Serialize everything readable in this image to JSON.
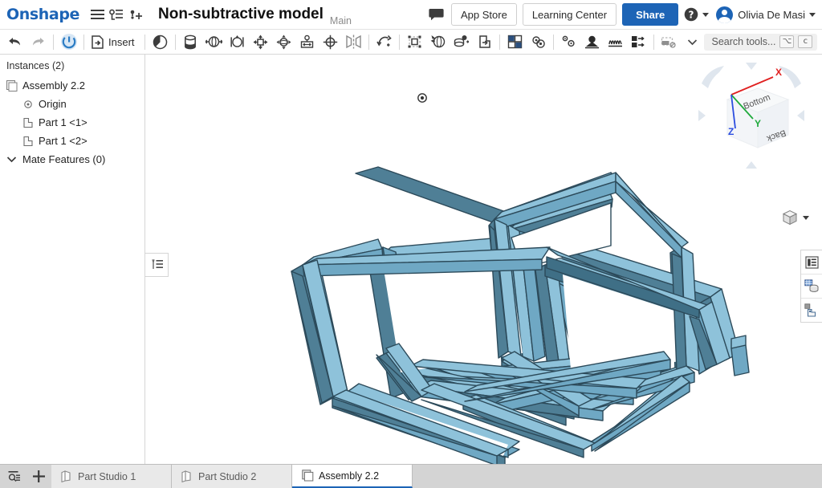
{
  "header": {
    "brand": "Onshape",
    "menu_icon": "hamburger-menu-icon",
    "versions_icon": "version-graph-icon",
    "branch_icon": "create-branch-icon",
    "document_title": "Non-subtractive model",
    "branch_label": "Main",
    "comment_icon": "comment-icon",
    "app_store_label": "App Store",
    "learning_center_label": "Learning Center",
    "share_label": "Share",
    "help_icon": "help-icon",
    "user_name": "Olivia De Masi",
    "avatar": "user-avatar"
  },
  "toolbar": {
    "undo_icon": "undo-icon",
    "redo_icon": "redo-icon",
    "rebuild_icon": "rebuild-icon",
    "insert_label": "Insert",
    "insert_icon": "insert-icon",
    "items": [
      {
        "name": "revolute-mate-icon",
        "label": "Revolute mate"
      },
      {
        "name": "fastened-mate-icon",
        "label": "Fastened mate"
      },
      {
        "name": "slider-mate-icon",
        "label": "Slider mate"
      },
      {
        "name": "cylindrical-mate-icon",
        "label": "Cylindrical mate"
      },
      {
        "name": "planar-mate-icon",
        "label": "Planar mate"
      },
      {
        "name": "ball-mate-icon",
        "label": "Ball mate"
      },
      {
        "name": "pin-slot-mate-icon",
        "label": "Pin slot mate"
      },
      {
        "name": "parallel-mate-icon",
        "label": "Parallel mate"
      },
      {
        "name": "mirror-mate-icon",
        "label": "Mirror mate"
      },
      {
        "name": "group-mate-icon",
        "label": "Group"
      },
      {
        "name": "transform-icon",
        "label": "Transform instance"
      },
      {
        "name": "replicate-icon",
        "label": "Replicate"
      },
      {
        "name": "pattern-icon",
        "label": "Pattern"
      },
      {
        "name": "explode-icon",
        "label": "Exploded view"
      },
      {
        "name": "assembly-feature-icon",
        "label": "Assembly feature"
      },
      {
        "name": "gear-tool-icon",
        "label": "Gear tool"
      },
      {
        "name": "spring-tool-icon",
        "label": "Spring tool"
      },
      {
        "name": "belt-tool-icon",
        "label": "Belt tool"
      },
      {
        "name": "insert-feature-icon",
        "label": "Insert feature"
      },
      {
        "name": "display-state-icon",
        "label": "Display state"
      }
    ],
    "search_placeholder": "Search tools...",
    "search_key_modifier": "⌥",
    "search_key_char": "c"
  },
  "sidebar": {
    "panel_title": "Instances (2)",
    "tree": [
      {
        "label": "Assembly 2.2",
        "icon": "assembly-icon",
        "indent": 0
      },
      {
        "label": "Origin",
        "icon": "origin-icon",
        "indent": 1
      },
      {
        "label": "Part 1 <1>",
        "icon": "part-icon",
        "indent": 1
      },
      {
        "label": "Part 1 <2>",
        "icon": "part-icon",
        "indent": 1
      },
      {
        "label": "Mate Features (0)",
        "icon": "chevron-down-icon",
        "indent": 0
      }
    ],
    "toggle_icon": "instance-list-icon"
  },
  "graphics": {
    "model_name": "two-interlocking-cube-frames",
    "body_color": "#8ec2da",
    "body_color_dark": "#4f7f96",
    "body_color_mid": "#6fa8c4",
    "edge_color": "#2c4a5a",
    "origin_marker": "origin-point-marker",
    "viewcube": {
      "face_top_label": "Bottom",
      "face_right_label": "Back",
      "axis_x_label": "X",
      "axis_y_label": "Y",
      "axis_z_label": "Z",
      "axis_x_color": "#e02020",
      "axis_y_color": "#1faa3c",
      "axis_z_color": "#2b4de0"
    },
    "view_menu_icon": "view-orientation-icon"
  },
  "right_rail": [
    {
      "name": "feature-list-icon",
      "label": "Display list"
    },
    {
      "name": "appearance-icon",
      "label": "Appearances"
    },
    {
      "name": "instance-properties-icon",
      "label": "Instance properties"
    }
  ],
  "tabbar": {
    "search_tabs_icon": "search-tabs-icon",
    "add_tab_icon": "add-tab-icon",
    "tabs": [
      {
        "label": "Part Studio 1",
        "icon": "part-studio-icon",
        "active": false
      },
      {
        "label": "Part Studio 2",
        "icon": "part-studio-icon",
        "active": false
      },
      {
        "label": "Assembly 2.2",
        "icon": "assembly-icon",
        "active": true
      }
    ]
  }
}
